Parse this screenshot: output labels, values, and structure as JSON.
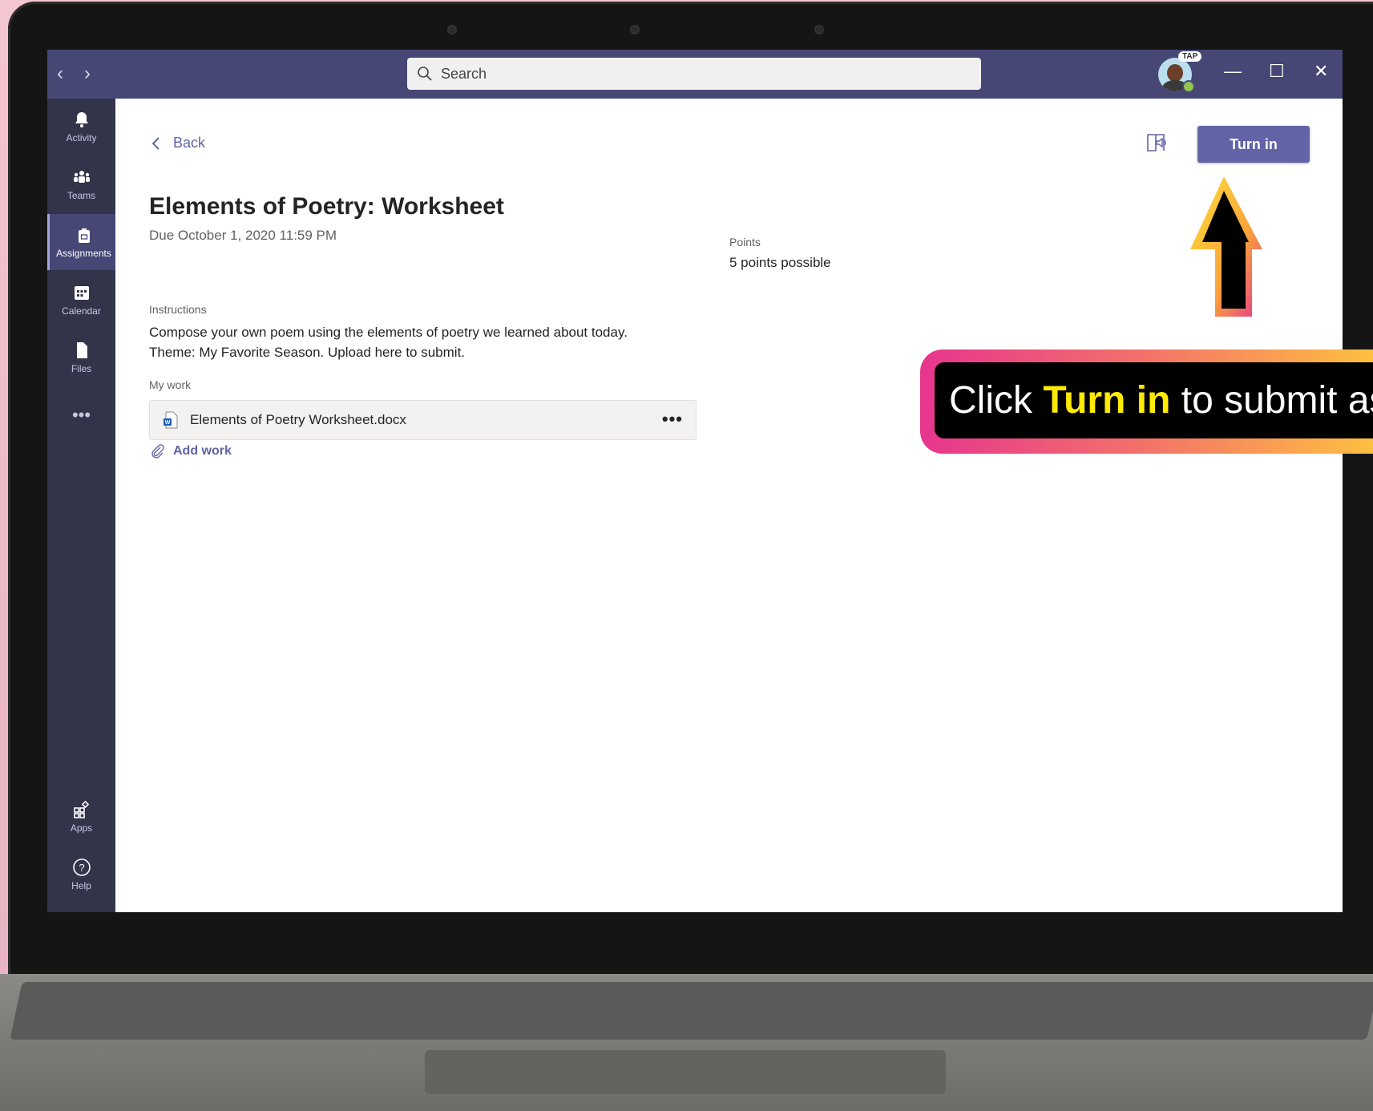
{
  "window": {
    "search_placeholder": "Search",
    "user_badge": "TAP"
  },
  "sidebar": {
    "items": [
      {
        "label": "Activity",
        "icon": "bell-icon"
      },
      {
        "label": "Teams",
        "icon": "teams-icon"
      },
      {
        "label": "Assignments",
        "icon": "backpack-icon"
      },
      {
        "label": "Calendar",
        "icon": "calendar-icon"
      },
      {
        "label": "Files",
        "icon": "file-icon"
      },
      {
        "label": "Apps",
        "icon": "apps-icon"
      },
      {
        "label": "Help",
        "icon": "help-icon"
      }
    ]
  },
  "assignment": {
    "back_label": "Back",
    "title": "Elements of Poetry: Worksheet",
    "due": "Due October 1, 2020 11:59 PM",
    "instructions_label": "Instructions",
    "instructions_line1": "Compose your own poem using the elements of poetry we learned about today.",
    "instructions_line2": "Theme: My Favorite Season. Upload here to submit.",
    "my_work_label": "My work",
    "file_name": "Elements of Poetry Worksheet.docx",
    "add_work_label": "Add work",
    "points_label": "Points",
    "points_value": "5 points possible",
    "turn_in_label": "Turn in"
  },
  "callout": {
    "prefix": "Click ",
    "bold": "Turn in",
    "suffix": " to submit as"
  },
  "colors": {
    "titlebar": "#464775",
    "sidebar": "#33344a",
    "accent": "#6264a7",
    "callout_highlight": "#ffeb00"
  }
}
